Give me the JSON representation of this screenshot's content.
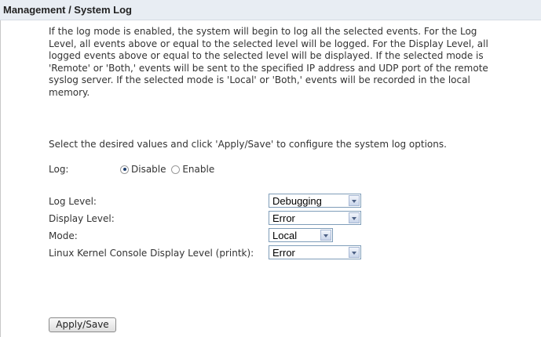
{
  "header": {
    "title": "Management / System Log"
  },
  "description": {
    "lines": [
      "If the log mode is enabled, the system will begin to log all the selected events. For the Log",
      "Level, all events above or equal to the selected level will be logged. For the Display Level, all",
      "logged events above or equal to the selected level will be displayed. If the selected mode is",
      "'Remote' or 'Both,' events will be sent to the specified IP address and UDP port of the remote",
      "syslog server. If the selected mode is 'Local' or 'Both,' events will be recorded in the local",
      "memory."
    ]
  },
  "instruction": "Select the desired values and click 'Apply/Save' to configure the system log options.",
  "log": {
    "label": "Log:",
    "options": [
      {
        "label": "Disable",
        "checked": true
      },
      {
        "label": "Enable",
        "checked": false
      }
    ]
  },
  "settings": [
    {
      "label": "Log Level:",
      "value": "Debugging"
    },
    {
      "label": "Display Level:",
      "value": "Error"
    },
    {
      "label": "Mode:",
      "value": "Local"
    },
    {
      "label": "Linux Kernel Console Display Level (printk):",
      "value": "Error"
    }
  ],
  "buttons": {
    "apply_save": "Apply/Save"
  },
  "colors": {
    "header_bg": "#e8edf3",
    "select_border": "#7f9db9",
    "text": "#333333"
  }
}
